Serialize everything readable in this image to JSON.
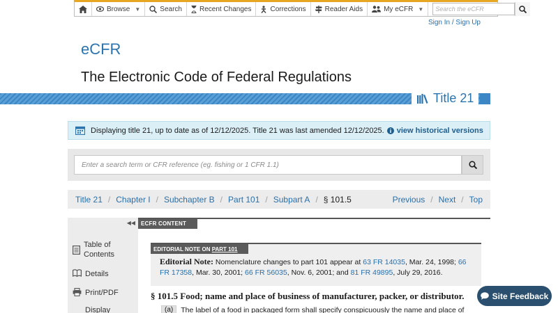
{
  "nav": {
    "browse": "Browse",
    "search": "Search",
    "recent_changes": "Recent Changes",
    "corrections": "Corrections",
    "reader_aids": "Reader Aids",
    "my_ecfr": "My eCFR",
    "search_placeholder": "Search the eCFR"
  },
  "signin": "Sign In / Sign Up",
  "brand": "eCFR",
  "site_title": "The Electronic Code of Federal Regulations",
  "title_label": "Title 21",
  "info": {
    "message": "Displaying title 21, up to date as of 12/12/2025. Title 21 was last amended 12/12/2025.",
    "link": "view historical versions"
  },
  "search": {
    "placeholder": "Enter a search term or CFR reference (eg. fishing or 1 CFR 1.1)"
  },
  "breadcrumb": {
    "items": [
      "Title 21",
      "Chapter I",
      "Subchapter B",
      "Part 101",
      "Subpart A"
    ],
    "current": "§ 101.5",
    "previous": "Previous",
    "next": "Next",
    "top": "Top"
  },
  "sidebar": {
    "toc_line1": "Table of",
    "toc_line2": "Contents",
    "details": "Details",
    "print": "Print/PDF",
    "display": "Display"
  },
  "content": {
    "tab": "ECFR CONTENT",
    "note_label": "EDITORIAL NOTE ON",
    "note_part": "PART 101",
    "note_title": "Editorial Note:",
    "note_text1": "Nomenclature changes to part 101 appear at",
    "ref1": "63 FR 14035",
    "date1": ", Mar. 24, 1998;",
    "ref2": "66 FR 17358",
    "date2": ", Mar. 30, 2001;",
    "ref3": "66 FR 56035",
    "date3": ", Nov. 6, 2001; and",
    "ref4": "81 FR 49895",
    "date4": ", July 29, 2016.",
    "section_heading": "§ 101.5 Food; name and place of business of manufacturer, packer, or distributor.",
    "para_num": "(a)",
    "para_text": "The label of a food in packaged form shall specify conspicuously the name and place of"
  },
  "feedback": "Site Feedback",
  "colors": {
    "accent_blue": "#2c74ad",
    "nav_top_border": "#e8a723",
    "feedback_bg": "#2b4f6e"
  }
}
